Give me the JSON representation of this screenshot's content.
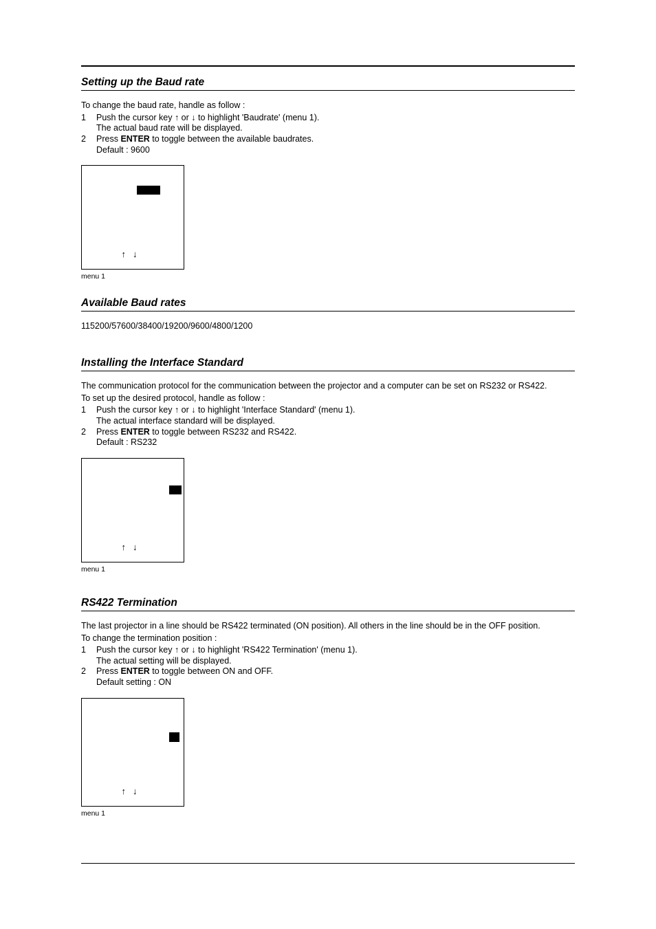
{
  "sections": {
    "baud": {
      "heading": "Setting up the Baud rate",
      "intro": "To change the baud rate, handle as follow :",
      "step1_num": "1",
      "step1_a": "Push the cursor key ",
      "step1_b": " or ",
      "step1_c": " to highlight 'Baudrate' (menu 1).",
      "step1_line2": "The actual baud rate will be displayed.",
      "step2_num": "2",
      "step2_pre": "Press ",
      "step2_enter": "ENTER",
      "step2_post": " to toggle between the available baudrates.",
      "step2_line2": "Default : 9600",
      "menu_caption": "menu 1",
      "arrow_up": "↑",
      "arrow_down": "↓"
    },
    "available": {
      "heading": "Available Baud rates",
      "rates": "115200/57600/38400/19200/9600/4800/1200"
    },
    "interface": {
      "heading": "Installing the Interface Standard",
      "intro1": "The communication protocol for the communication between the projector and a computer can be set on RS232 or RS422.",
      "intro2": "To set up the desired protocol, handle as follow :",
      "step1_num": "1",
      "step1_a": "Push the cursor key ",
      "step1_b": " or ",
      "step1_c": " to highlight 'Interface Standard' (menu 1).",
      "step1_line2": "The actual interface standard will be displayed.",
      "step2_num": "2",
      "step2_pre": "Press ",
      "step2_enter": "ENTER",
      "step2_post": " to toggle between RS232 and RS422.",
      "step2_line2": "Default : RS232",
      "menu_caption": "menu 1",
      "arrow_up": "↑",
      "arrow_down": "↓"
    },
    "rs422": {
      "heading": "RS422 Termination",
      "intro1": "The last projector in a line should be RS422 terminated (ON position).  All others in the line should be in the OFF position.",
      "intro2": "To change the termination position :",
      "step1_num": "1",
      "step1_a": "Push the cursor key ",
      "step1_b": " or ",
      "step1_c": " to highlight 'RS422 Termination' (menu 1).",
      "step1_line2": "The actual setting will be displayed.",
      "step2_num": "2",
      "step2_pre": "Press ",
      "step2_enter": "ENTER",
      "step2_post": " to toggle between ON and OFF.",
      "step2_line2": "Default setting : ON",
      "menu_caption": "menu 1",
      "arrow_up": "↑",
      "arrow_down": "↓"
    }
  },
  "icons": {
    "up": "↑",
    "down": "↓"
  }
}
